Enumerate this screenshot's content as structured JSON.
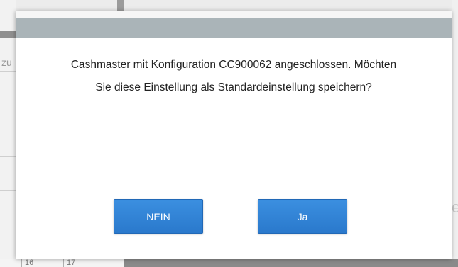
{
  "background": {
    "left_cut_text": "zu",
    "right_glyph": "e",
    "calendar_cells": [
      "16",
      "17"
    ]
  },
  "dialog": {
    "message_line1": "Cashmaster mit Konfiguration CC900062 angeschlossen. Möchten",
    "message_line2": "Sie diese Einstellung als Standardeinstellung speichern?",
    "no_button": "NEIN",
    "yes_button": "Ja"
  },
  "colors": {
    "header_bar": "#aab4b8",
    "button_blue": "#2a79cc"
  }
}
